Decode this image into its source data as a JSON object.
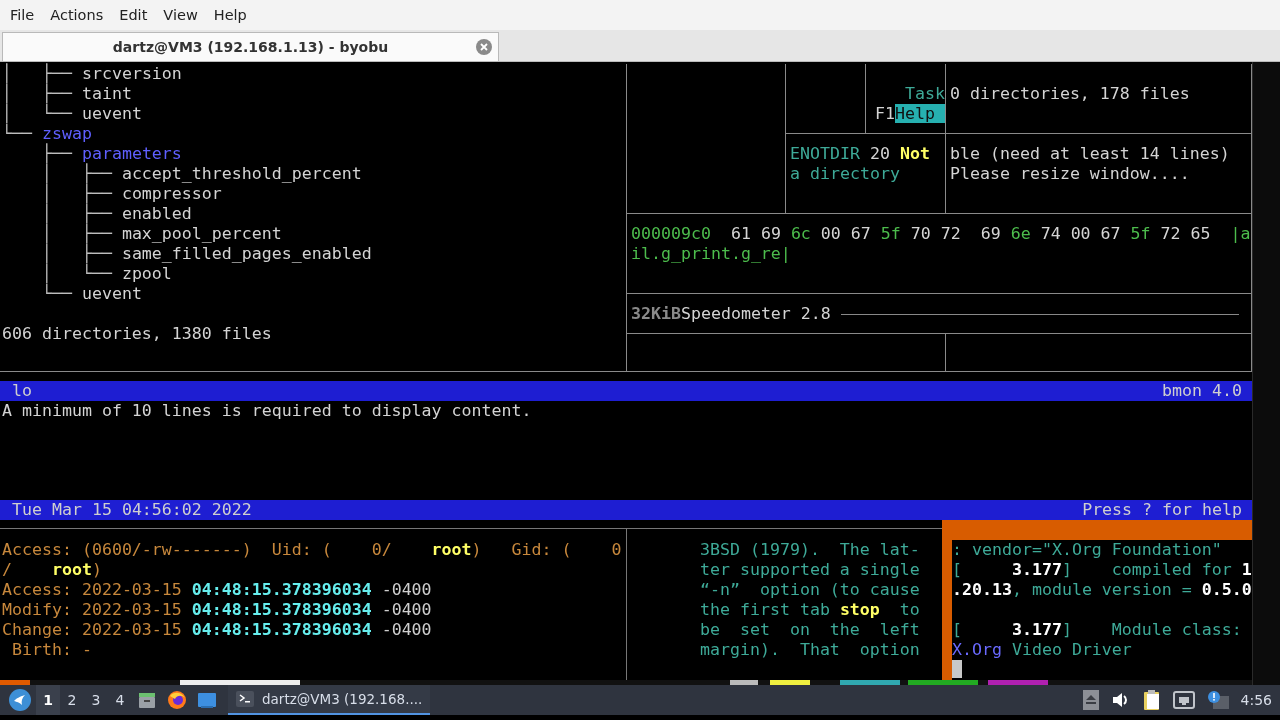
{
  "menu": [
    {
      "label": "File"
    },
    {
      "label": "Actions"
    },
    {
      "label": "Edit"
    },
    {
      "label": "View"
    },
    {
      "label": "Help"
    }
  ],
  "tabs": [
    {
      "title": "dartz@VM3 (192.168.1.13) - byobu",
      "selected": true
    }
  ],
  "tree": {
    "lines": [
      [
        {
          "text": "│   ├── ",
          "kind": "tree"
        },
        {
          "text": "srcversion",
          "kind": "plain"
        }
      ],
      [
        {
          "text": "│   ├── ",
          "kind": "tree"
        },
        {
          "text": "taint",
          "kind": "plain"
        }
      ],
      [
        {
          "text": "│   └── ",
          "kind": "tree"
        },
        {
          "text": "uevent",
          "kind": "plain"
        }
      ],
      [
        {
          "text": "└── ",
          "kind": "tree"
        },
        {
          "text": "zswap",
          "kind": "dir"
        }
      ],
      [
        {
          "text": "    ├── ",
          "kind": "tree"
        },
        {
          "text": "parameters",
          "kind": "dir"
        }
      ],
      [
        {
          "text": "    │   ├── ",
          "kind": "tree"
        },
        {
          "text": "accept_threshold_percent",
          "kind": "plain"
        }
      ],
      [
        {
          "text": "    │   ├── ",
          "kind": "tree"
        },
        {
          "text": "compressor",
          "kind": "plain"
        }
      ],
      [
        {
          "text": "    │   ├── ",
          "kind": "tree"
        },
        {
          "text": "enabled",
          "kind": "plain"
        }
      ],
      [
        {
          "text": "    │   ├── ",
          "kind": "tree"
        },
        {
          "text": "max_pool_percent",
          "kind": "plain"
        }
      ],
      [
        {
          "text": "    │   ├── ",
          "kind": "tree"
        },
        {
          "text": "same_filled_pages_enabled",
          "kind": "plain"
        }
      ],
      [
        {
          "text": "    │   └── ",
          "kind": "tree"
        },
        {
          "text": "zpool",
          "kind": "plain"
        }
      ],
      [
        {
          "text": "    └── ",
          "kind": "tree"
        },
        {
          "text": "uevent",
          "kind": "plain"
        }
      ]
    ],
    "summary": "606 directories, 1380 files"
  },
  "htop": {
    "label": "Task",
    "key": "F1",
    "key_label": "Help"
  },
  "tree_count": "0 directories, 178 files",
  "error_pane": {
    "lines": [
      [
        {
          "text": "ENOTDIR",
          "kind": "teal"
        },
        {
          "text": " 20 ",
          "kind": "plain"
        },
        {
          "text": "Not",
          "kind": "yellow"
        }
      ],
      [
        {
          "text": "a directory",
          "kind": "teal"
        }
      ]
    ]
  },
  "resize_notice": {
    "lines": [
      "ble (need at least 14 lines)",
      "Please resize window...."
    ]
  },
  "hexdump": {
    "lines": [
      [
        {
          "text": "000009c0",
          "kind": "green"
        },
        {
          "text": "  61 69 ",
          "kind": "plain"
        },
        {
          "text": "6c",
          "kind": "green"
        },
        {
          "text": " 00 67 ",
          "kind": "plain"
        },
        {
          "text": "5f",
          "kind": "green"
        },
        {
          "text": " 70 72  69 ",
          "kind": "plain"
        },
        {
          "text": "6e",
          "kind": "green"
        },
        {
          "text": " 74 00 67 ",
          "kind": "plain"
        },
        {
          "text": "5f",
          "kind": "green"
        },
        {
          "text": " 72 65  ",
          "kind": "plain"
        },
        {
          "text": "|a",
          "kind": "green"
        }
      ],
      [
        {
          "text": "il.g_print.g_re|",
          "kind": "green"
        }
      ]
    ]
  },
  "speedometer": {
    "size": "32KiB",
    "title": "Speedometer 2.8"
  },
  "bmon": {
    "interface": "lo",
    "title": "bmon 4.0",
    "message": "A minimum of 10 lines is required to display content.",
    "date": "Tue Mar 15 04:56:02 2022",
    "help_hint": "Press ? for help"
  },
  "stat": {
    "lines": [
      [
        {
          "text": "Access: (0600/-rw-------)  Uid: (    0/    ",
          "kind": "orange"
        },
        {
          "text": "root",
          "kind": "yellow"
        },
        {
          "text": ")   Gid: (    0",
          "kind": "orange"
        }
      ],
      [
        {
          "text": "/    ",
          "kind": "orange"
        },
        {
          "text": "root",
          "kind": "yellow"
        },
        {
          "text": ")",
          "kind": "orange"
        }
      ],
      [
        {
          "text": "Access: 2022-03-15 ",
          "kind": "orange"
        },
        {
          "text": "04:48:15.378396034",
          "kind": "cyan"
        },
        {
          "text": " -0400",
          "kind": "gray"
        }
      ],
      [
        {
          "text": "Modify: 2022-03-15 ",
          "kind": "orange"
        },
        {
          "text": "04:48:15.378396034",
          "kind": "cyan"
        },
        {
          "text": " -0400",
          "kind": "gray"
        }
      ],
      [
        {
          "text": "Change: 2022-03-15 ",
          "kind": "orange"
        },
        {
          "text": "04:48:15.378396034",
          "kind": "cyan"
        },
        {
          "text": " -0400",
          "kind": "gray"
        }
      ],
      [
        {
          "text": " Birth: -",
          "kind": "orange"
        }
      ]
    ]
  },
  "man_page": {
    "lines": [
      [
        {
          "text": "3BSD (1979).  The lat-",
          "kind": "teal"
        }
      ],
      [
        {
          "text": "ter supported a single",
          "kind": "teal"
        }
      ],
      [
        {
          "text": "“-n”  option (to cause",
          "kind": "teal"
        }
      ],
      [
        {
          "text": "the first tab ",
          "kind": "teal"
        },
        {
          "text": "stop",
          "kind": "yellow"
        },
        {
          "text": "  to",
          "kind": "teal"
        }
      ],
      [
        {
          "text": "be  set  on  the  left",
          "kind": "teal"
        }
      ],
      [
        {
          "text": "margin).  That  option",
          "kind": "teal"
        }
      ]
    ]
  },
  "dmesg": {
    "entries": [
      {
        "lines": [
          [
            {
              "text": ": vendor=\"X.Org Foundation\"",
              "kind": "teal"
            }
          ],
          [
            {
              "text": "[",
              "kind": "teal"
            },
            {
              "text": "     3.177",
              "kind": "white"
            },
            {
              "text": "]    compiled for ",
              "kind": "teal"
            },
            {
              "text": "1",
              "kind": "white"
            }
          ],
          [
            {
              "text": ".20.13",
              "kind": "white"
            },
            {
              "text": ", module version = ",
              "kind": "teal"
            },
            {
              "text": "0.5.0",
              "kind": "white"
            }
          ]
        ]
      },
      {
        "lines": [
          [
            {
              "text": "[",
              "kind": "teal"
            },
            {
              "text": "     3.177",
              "kind": "white"
            },
            {
              "text": "]    Module class: ",
              "kind": "teal"
            }
          ],
          [
            {
              "text": "X.Org",
              "kind": "blue"
            },
            {
              "text": " Video Driver",
              "kind": "teal"
            }
          ]
        ]
      }
    ]
  },
  "taskbar": {
    "workspaces": [
      {
        "label": "1",
        "selected": true
      },
      {
        "label": "2",
        "selected": false
      },
      {
        "label": "3",
        "selected": false
      },
      {
        "label": "4",
        "selected": false
      }
    ],
    "tasks": [
      {
        "label": "dartz@VM3 (192.168....",
        "selected": true
      }
    ],
    "clock": "4:56"
  }
}
